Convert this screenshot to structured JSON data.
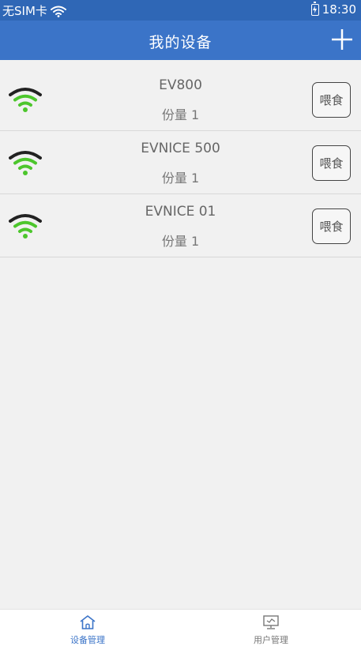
{
  "status_bar": {
    "carrier": "无SIM卡",
    "time": "18:30"
  },
  "header": {
    "title": "我的设备"
  },
  "devices": [
    {
      "name": "EV800",
      "portion": "份量 1",
      "feed_label": "喂食"
    },
    {
      "name": "EVNICE 500",
      "portion": "份量 1",
      "feed_label": "喂食"
    },
    {
      "name": "EVNICE 01",
      "portion": "份量 1",
      "feed_label": "喂食"
    }
  ],
  "tabs": {
    "devices_label": "设备管理",
    "users_label": "用户管理"
  },
  "colors": {
    "status_bar": "#2f67b6",
    "header": "#3b74c8",
    "wifi_green": "#4cc62c",
    "wifi_dark": "#222222",
    "active_tab": "#3b74c8"
  },
  "icons": {
    "wifi": "wifi-icon",
    "add": "plus-icon",
    "devices_tab": "home-icon",
    "users_tab": "presentation-icon"
  }
}
